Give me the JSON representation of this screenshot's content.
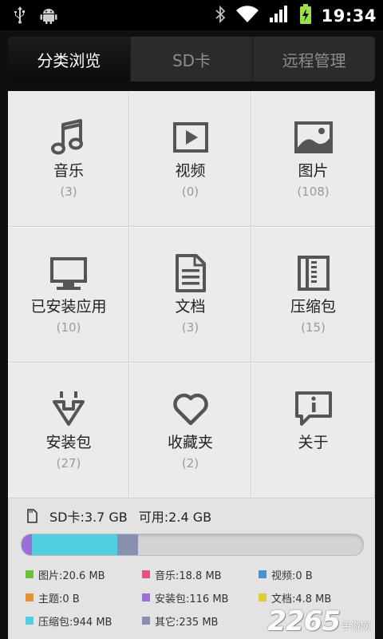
{
  "status": {
    "time": "19:34",
    "left_icons": [
      "usb-icon",
      "android-debug-icon"
    ],
    "right_icons": [
      "bluetooth-icon",
      "wifi-icon",
      "signal-icon",
      "battery-charging-icon"
    ]
  },
  "tabs": [
    {
      "label": "分类浏览",
      "active": true
    },
    {
      "label": "SD卡",
      "active": false
    },
    {
      "label": "远程管理",
      "active": false
    }
  ],
  "categories": [
    {
      "label": "音乐",
      "count": "(3)",
      "icon": "music-icon"
    },
    {
      "label": "视频",
      "count": "(0)",
      "icon": "video-icon"
    },
    {
      "label": "图片",
      "count": "(108)",
      "icon": "image-icon"
    },
    {
      "label": "已安装应用",
      "count": "(10)",
      "icon": "installed-apps-icon"
    },
    {
      "label": "文档",
      "count": "(3)",
      "icon": "document-icon"
    },
    {
      "label": "压缩包",
      "count": "(15)",
      "icon": "archive-icon"
    },
    {
      "label": "安装包",
      "count": "(27)",
      "icon": "install-package-icon"
    },
    {
      "label": "收藏夹",
      "count": "(2)",
      "icon": "favorites-icon"
    },
    {
      "label": "关于",
      "count": "",
      "icon": "info-icon"
    }
  ],
  "storage": {
    "sd_label": "SD卡:3.7 GB",
    "free_label": "可用:2.4 GB",
    "usage_fractions": {
      "install_package": 0.031,
      "archive": 0.249,
      "other": 0.062
    },
    "colors": {
      "install_package": "#9b6fd6",
      "archive": "#4fcfe0",
      "other": "#8890b0"
    }
  },
  "legend": [
    {
      "label": "图片:20.6 MB",
      "color": "#6cbf3a"
    },
    {
      "label": "音乐:18.8 MB",
      "color": "#e0557a"
    },
    {
      "label": "视频:0 B",
      "color": "#4a8fd0"
    },
    {
      "label": "主题:0 B",
      "color": "#e7902f"
    },
    {
      "label": "安装包:116 MB",
      "color": "#9b6fd6"
    },
    {
      "label": "文档:4.8 MB",
      "color": "#e2cc36"
    },
    {
      "label": "压缩包:944 MB",
      "color": "#4fcfe0"
    },
    {
      "label": "其它:235 MB",
      "color": "#8890b0"
    }
  ],
  "watermark": {
    "number": "2265",
    "text": "手游网"
  }
}
